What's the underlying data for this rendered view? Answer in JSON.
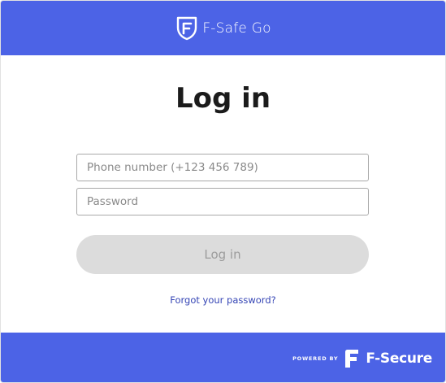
{
  "header": {
    "brand_name": "F-Safe Go",
    "logo_icon": "shield-f-icon",
    "background_color": "#4c63e6"
  },
  "main": {
    "title": "Log in",
    "phone_field": {
      "placeholder": "Phone number (+123 456 789)",
      "value": ""
    },
    "password_field": {
      "placeholder": "Password",
      "value": ""
    },
    "login_button_label": "Log in",
    "login_button_state": "disabled",
    "forgot_password_link": "Forgot your password?"
  },
  "footer": {
    "powered_by": "POWERED BY",
    "company_name": "F-Secure",
    "company_logo_icon": "f-secure-logo-icon",
    "background_color": "#4c63e6"
  }
}
